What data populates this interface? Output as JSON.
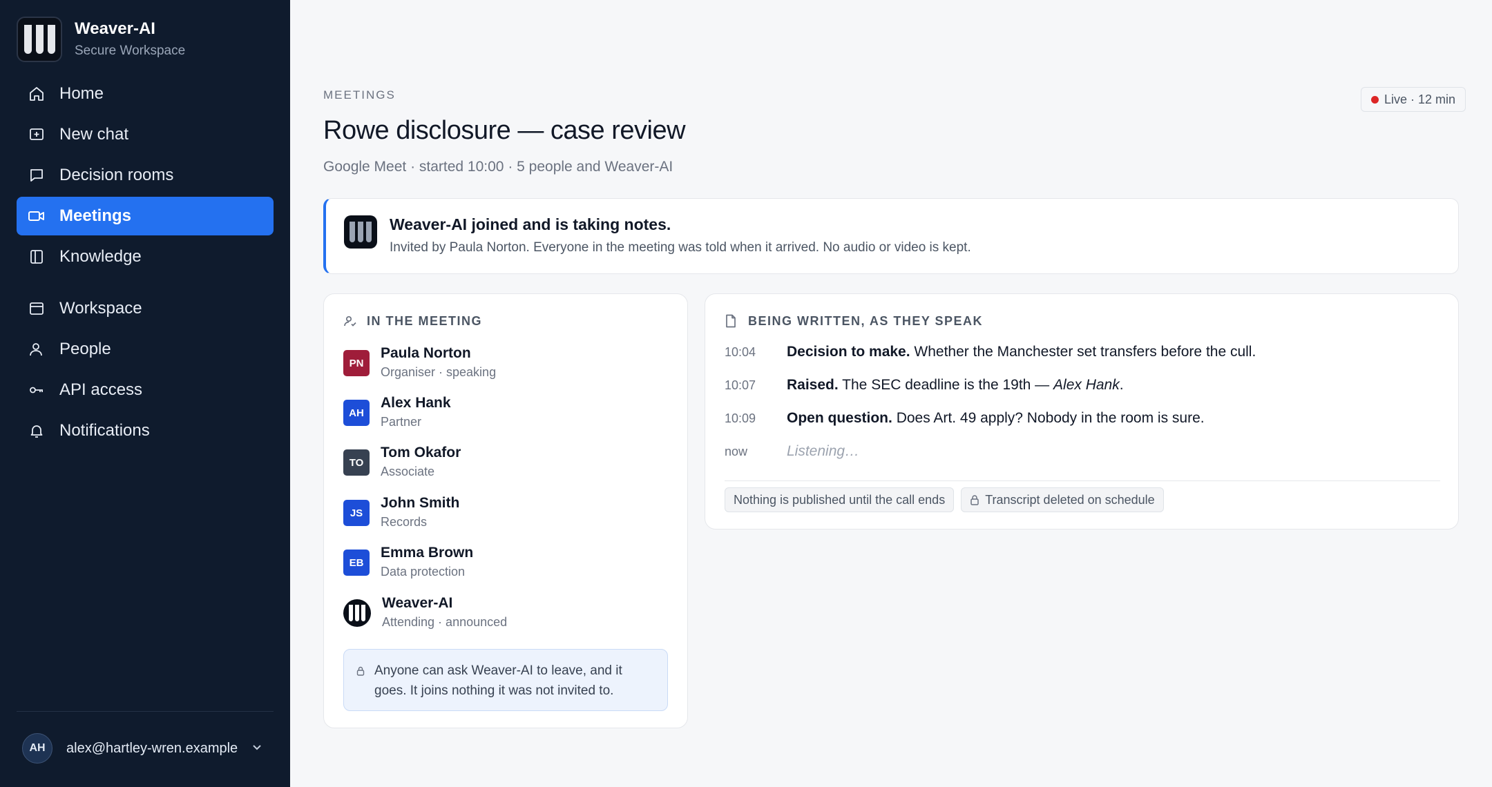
{
  "brand": {
    "name": "Weaver-AI",
    "subtitle": "Secure Workspace"
  },
  "sidebar": {
    "items": [
      {
        "label": "Home",
        "icon": "home-icon"
      },
      {
        "label": "New chat",
        "icon": "new-chat-icon"
      },
      {
        "label": "Decision rooms",
        "icon": "chat-bubble-icon"
      },
      {
        "label": "Meetings",
        "icon": "video-icon",
        "active": true
      },
      {
        "label": "Knowledge",
        "icon": "book-icon"
      },
      {
        "label": "Workspace",
        "icon": "window-icon"
      },
      {
        "label": "People",
        "icon": "person-icon"
      },
      {
        "label": "API access",
        "icon": "key-icon"
      },
      {
        "label": "Notifications",
        "icon": "bell-icon"
      }
    ],
    "account": {
      "initials": "AH",
      "email": "alex@hartley-wren.example"
    }
  },
  "header": {
    "eyebrow": "MEETINGS",
    "title": "Rowe disclosure — case review",
    "subtitle": "Google Meet · started 10:00 · 5 people and Weaver-AI",
    "live_badge": "Live · 12 min"
  },
  "notice": {
    "title": "Weaver-AI joined and is taking notes.",
    "body": "Invited by Paula Norton. Everyone in the meeting was told when it arrived. No audio or video is kept."
  },
  "people_panel": {
    "heading": "IN THE MEETING",
    "people": [
      {
        "initials": "PN",
        "name": "Paula Norton",
        "role": "Organiser · speaking",
        "color": "#9f1d3a"
      },
      {
        "initials": "AH",
        "name": "Alex Hank",
        "role": "Partner",
        "color": "#1d4ed8"
      },
      {
        "initials": "TO",
        "name": "Tom Okafor",
        "role": "Associate",
        "color": "#374151"
      },
      {
        "initials": "JS",
        "name": "John Smith",
        "role": "Records",
        "color": "#1d4ed8"
      },
      {
        "initials": "EB",
        "name": "Emma Brown",
        "role": "Data protection",
        "color": "#1d4ed8"
      },
      {
        "initials": "",
        "name": "Weaver-AI",
        "role": "Attending · announced",
        "color": "#0a0f18"
      }
    ],
    "leave_note": "Anyone can ask Weaver-AI to leave, and it goes. It joins nothing it was not invited to."
  },
  "notes_panel": {
    "heading": "BEING WRITTEN, AS THEY SPEAK",
    "entries": [
      {
        "time": "10:04",
        "label": "Decision to make.",
        "text": "Whether the Manchester set transfers before the cull."
      },
      {
        "time": "10:07",
        "label": "Raised.",
        "text": "The SEC deadline is the 19th —",
        "attribution": "Alex Hank",
        "end": "."
      },
      {
        "time": "10:09",
        "label": "Open question.",
        "text": "Does Art. 49 apply? Nobody in the room is sure."
      },
      {
        "time": "now",
        "label": "",
        "text": "Listening…"
      }
    ],
    "chips": [
      "Nothing is published until the call ends",
      "Transcript deleted on schedule"
    ]
  },
  "colors": {
    "accent": "#2471f0",
    "sidebar_bg": "#0f1b2d",
    "live": "#dc2626"
  }
}
